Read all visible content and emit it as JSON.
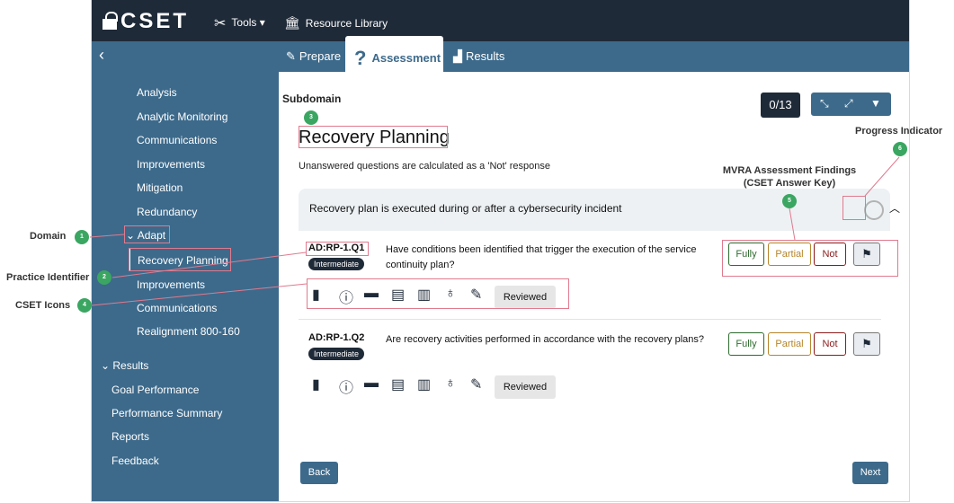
{
  "topbar": {
    "logo": "CSET",
    "tools_label": "Tools",
    "resource_library_label": "Resource Library"
  },
  "tabs": {
    "prepare": "Prepare",
    "assessment": "Assessment",
    "results": "Results"
  },
  "sidebar": {
    "items": [
      "Analysis",
      "Analytic Monitoring",
      "Communications",
      "Improvements",
      "Mitigation",
      "Redundancy"
    ],
    "adapt_label": "Adapt",
    "active_item": "Recovery Planning",
    "items_after": [
      "Improvements",
      "Communications",
      "Realignment 800-160"
    ],
    "results_label": "Results",
    "results_items": [
      "Goal Performance",
      "Performance Summary",
      "Reports",
      "Feedback"
    ]
  },
  "main": {
    "subdomain_label": "Subdomain",
    "title": "Recovery Planning",
    "note": "Unanswered questions are calculated as a 'Not' response",
    "progress": "0/13",
    "question_group_title": "Recovery plan is executed during or after a cybersecurity incident",
    "questions": [
      {
        "id": "AD:RP-1.Q1",
        "level": "Intermediate",
        "text": "Have conditions been identified that trigger the execution of the service continuity plan?",
        "answers": {
          "fully": "Fully",
          "partial": "Partial",
          "not": "Not"
        },
        "reviewed": "Reviewed"
      },
      {
        "id": "AD:RP-1.Q2",
        "level": "Intermediate",
        "text": "Are recovery activities performed in accordance with the recovery plans?",
        "answers": {
          "fully": "Fully",
          "partial": "Partial",
          "not": "Not"
        },
        "reviewed": "Reviewed"
      }
    ],
    "back_button": "Back",
    "next_button": "Next"
  },
  "annotations": {
    "domain": "Domain",
    "practice_identifier": "Practice Identifier",
    "cset_icons": "CSET Icons",
    "mvra_findings_line1": "MVRA Assessment Findings",
    "mvra_findings_line2": "(CSET Answer Key)",
    "progress_indicator": "Progress Indicator",
    "numbers": [
      "1",
      "2",
      "3",
      "4",
      "5",
      "6"
    ]
  },
  "colors": {
    "topbar": "#1f2a38",
    "accent": "#3d6a8b",
    "annotation_box": "#e07a8e",
    "annotation_dot": "#3aa661",
    "fully": "#2f6b2f",
    "partial": "#b5852a",
    "not": "#8b1a1a"
  },
  "icons": [
    "lock-icon",
    "tools-icon",
    "library-icon",
    "chevron-left-icon",
    "edit-icon",
    "question-icon",
    "results-chart-icon",
    "chevron-down-icon",
    "book-icon",
    "info-icon",
    "comment-icon",
    "document-icon",
    "library-books-icon",
    "lightbulb-icon",
    "feedback-icon",
    "flag-icon",
    "collapse-icon",
    "expand-icon",
    "filter-icon",
    "progress-circle-icon",
    "chevron-up-icon"
  ]
}
